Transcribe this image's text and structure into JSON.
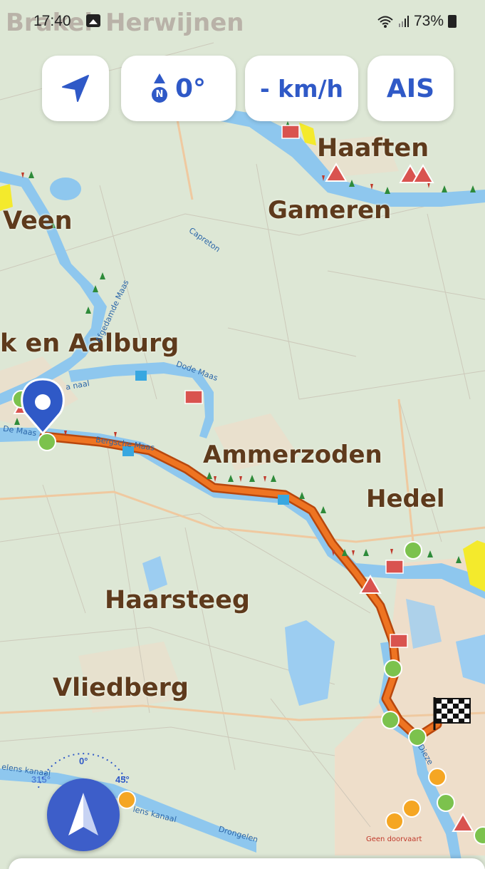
{
  "status_bar": {
    "time": "17:40",
    "battery": "73%"
  },
  "top_buttons": {
    "heading_value": "0°",
    "north_letter": "N",
    "speed": "- km/h",
    "ais": "AIS"
  },
  "map": {
    "places": {
      "brakel": "Brakel",
      "herwijnen": "Herwijnen",
      "haaften": "Haaften",
      "gameren": "Gameren",
      "veen": "Veen",
      "aalburg": "k en Aalburg",
      "ammerzoden": "Ammerzoden",
      "hedel": "Hedel",
      "haarsteeg": "Haarsteeg",
      "vliedberg": "Vliedberg"
    },
    "waterways": {
      "capreton": "Capreton",
      "dode_maas": "Dode Maas",
      "afgedamde_maas": "Afgedamde Maas",
      "maas_naar": "a naal",
      "de_maas": "De Maas",
      "bergsche_maas": "Bergsche Maas",
      "lens_kanaal_1": "elens kanaal",
      "lens_kanaal_2": "lens kanaal",
      "drongelen": "Drongelen",
      "dieze": "Dieze"
    },
    "geen_doorvaart": "Geen doorvaart"
  },
  "compass_dial": {
    "label_0": "0°",
    "label_45": "45°",
    "label_315": "315°"
  },
  "colors": {
    "accent": "#2f59c7",
    "route": "#e0661c",
    "water": "#8ec7ee",
    "land": "#dbe6d3",
    "waypoint_green": "#7cc24d",
    "waypoint_orange": "#f5a623"
  }
}
